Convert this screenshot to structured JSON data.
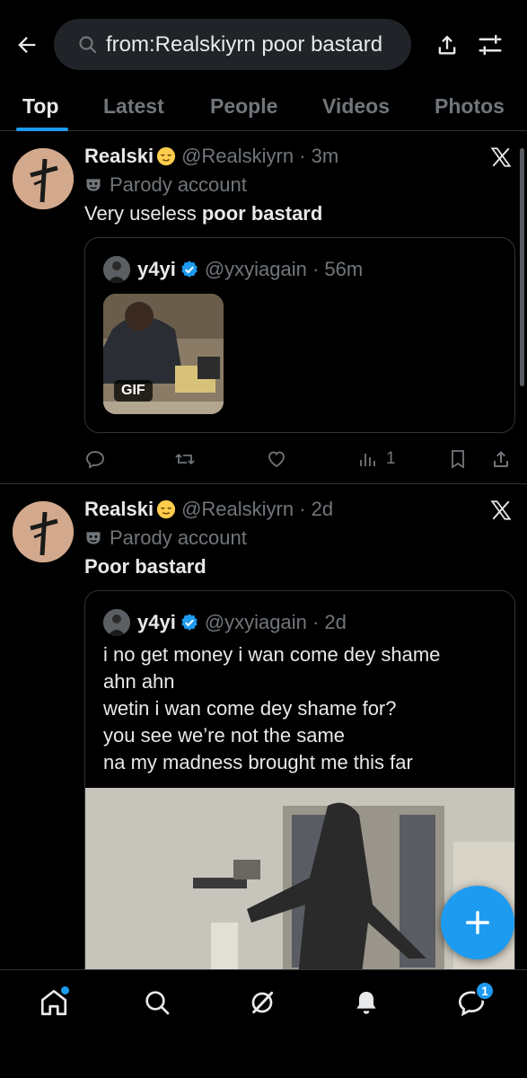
{
  "search": {
    "query": "from:Realskiyrn poor bastard"
  },
  "tabs": [
    {
      "label": "Top"
    },
    {
      "label": "Latest"
    },
    {
      "label": "People"
    },
    {
      "label": "Videos"
    },
    {
      "label": "Photos"
    }
  ],
  "tweets": [
    {
      "name": "Realski",
      "handle_time": "@Realskiyrn · 3m",
      "parody_label": "Parody account",
      "text_plain": "Very useless ",
      "text_bold": "poor bastard",
      "quote": {
        "name": "y4yi",
        "handle_time": "@yxyiagain · 56m",
        "media_badge": "GIF"
      },
      "views": "1"
    },
    {
      "name": "Realski",
      "handle_time": "@Realskiyrn · 2d",
      "parody_label": "Parody account",
      "text_plain": "",
      "text_bold": "Poor bastard",
      "quote": {
        "name": "y4yi",
        "handle_time": "@yxyiagain · 2d",
        "lines": [
          "i no get money i wan come dey shame",
          "ahn ahn",
          "wetin i wan come dey shame for?",
          "you see we’re not the same",
          "na my madness brought me this far"
        ]
      }
    }
  ],
  "nav": {
    "messages_badge": "1"
  },
  "colors": {
    "accent": "#1d9bf0",
    "background": "#000000",
    "muted": "#71767b",
    "border": "#2f3336"
  },
  "icons": [
    "back-arrow-icon",
    "search-icon",
    "share-icon",
    "filter-icon",
    "x-logo-icon",
    "reply-icon",
    "repost-icon",
    "like-icon",
    "views-icon",
    "bookmark-icon",
    "home-icon",
    "grok-icon",
    "bell-icon",
    "messages-icon",
    "compose-icon"
  ]
}
